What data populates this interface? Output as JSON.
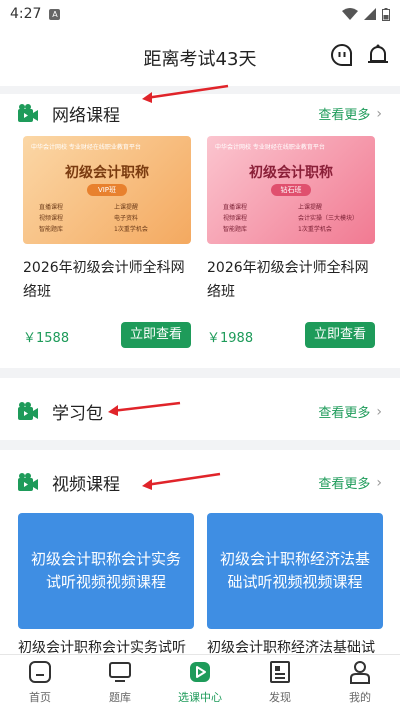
{
  "status": {
    "time": "4:27",
    "notif": "A"
  },
  "header": {
    "title": "距离考试43天"
  },
  "sections": {
    "network": {
      "title": "网络课程",
      "more": "查看更多"
    },
    "package": {
      "title": "学习包",
      "more": "查看更多"
    },
    "video": {
      "title": "视频课程",
      "more": "查看更多"
    }
  },
  "courses": [
    {
      "banner_top": "中华会计网校 专业财经在线职业教育平台",
      "banner_title": "初级会计职称",
      "banner_badge": "VIP班",
      "features": [
        "直播课程",
        "上课提醒",
        "视频课程",
        "电子资料",
        "智能题库",
        "1次重学机会"
      ],
      "name": "2026年初级会计师全科网络班",
      "price": "￥1588",
      "button": "立即查看"
    },
    {
      "banner_top": "中华会计网校 专业财经在线职业教育平台",
      "banner_title": "初级会计职称",
      "banner_badge": "钻石班",
      "features": [
        "直播课程",
        "上课提醒",
        "视频课程",
        "会计实操（三大模块）",
        "智能题库",
        "1次重学机会"
      ],
      "name": "2026年初级会计师全科网络班",
      "price": "￥1988",
      "button": "立即查看"
    }
  ],
  "videos": [
    {
      "card": "初级会计职称会计实务试听视频视频课程",
      "name": "初级会计职称会计实务试听"
    },
    {
      "card": "初级会计职称经济法基础试听视频视频课程",
      "name": "初级会计职称经济法基础试"
    }
  ],
  "tabs": [
    {
      "label": "首页",
      "icon": "home-icon"
    },
    {
      "label": "题库",
      "icon": "monitor-icon"
    },
    {
      "label": "选课中心",
      "icon": "play-icon"
    },
    {
      "label": "发现",
      "icon": "news-icon"
    },
    {
      "label": "我的",
      "icon": "user-icon"
    }
  ],
  "colors": {
    "accent": "#1e9b5a",
    "video_card": "#3f8ee3",
    "annotation_arrow": "#e0242a"
  }
}
